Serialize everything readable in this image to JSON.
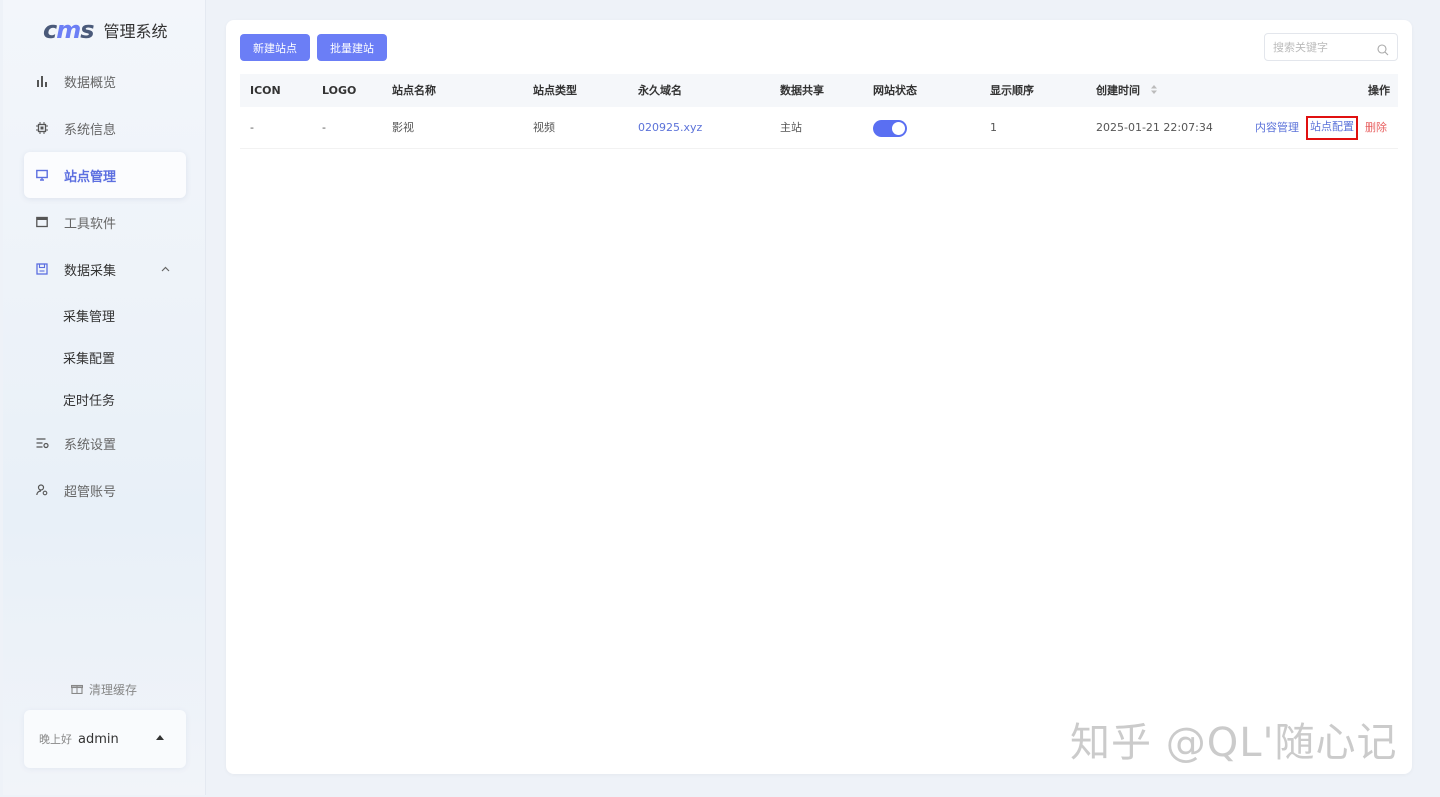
{
  "app": {
    "logo_mark_a": "c",
    "logo_mark_b": "m",
    "logo_mark_c": "s",
    "title": "管理系统"
  },
  "sidebar": {
    "items": [
      {
        "label": "数据概览",
        "icon": "bar-chart-icon"
      },
      {
        "label": "系统信息",
        "icon": "cpu-icon"
      },
      {
        "label": "站点管理",
        "icon": "monitor-icon",
        "active": true
      },
      {
        "label": "工具软件",
        "icon": "window-icon"
      },
      {
        "label": "数据采集",
        "icon": "save-icon",
        "expanded": true
      },
      {
        "label": "系统设置",
        "icon": "settings-sliders-icon"
      },
      {
        "label": "超管账号",
        "icon": "user-gear-icon"
      }
    ],
    "sub_items": [
      "采集管理",
      "采集配置",
      "定时任务"
    ],
    "clear_cache": "清理缓存",
    "user": {
      "greeting": "晚上好",
      "name": "admin"
    }
  },
  "toolbar": {
    "new_site": "新建站点",
    "batch_site": "批量建站",
    "search_placeholder": "搜索关键字"
  },
  "table": {
    "columns": [
      "ICON",
      "LOGO",
      "站点名称",
      "站点类型",
      "永久域名",
      "数据共享",
      "网站状态",
      "显示顺序",
      "创建时间",
      "操作"
    ],
    "rows": [
      {
        "icon": "-",
        "logo": "-",
        "name": "影视",
        "type": "视频",
        "domain": "020925.xyz",
        "share": "主站",
        "status_on": true,
        "order": "1",
        "created": "2025-01-21 22:07:34",
        "actions": [
          "内容管理",
          "站点配置",
          "删除"
        ]
      }
    ]
  },
  "watermark": "知乎 @QL'随心记",
  "colors": {
    "accent": "#6b7ef6",
    "danger": "#e86060",
    "highlight_box": "#e01010"
  }
}
